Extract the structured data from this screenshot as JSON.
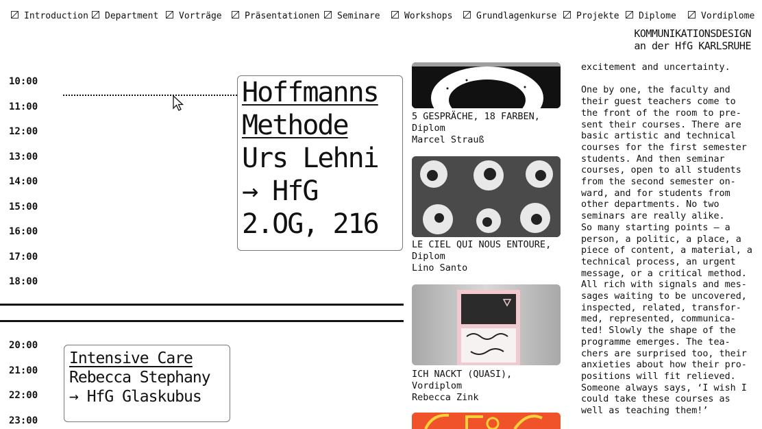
{
  "nav": {
    "items": [
      "Introduction",
      "Department",
      "Vorträge",
      "Präsentationen",
      "Seminare",
      "Workshops",
      "Grundlagenkurse",
      "Projekte",
      "Diplome",
      "Vordiplome"
    ]
  },
  "brand": {
    "line1": "KOMMUNIKATIONSDESIGN",
    "line2": "an der HfG KARLSRUHE"
  },
  "schedule": {
    "times_top": [
      "10:00",
      "11:00",
      "12:00",
      "13:00",
      "14:00",
      "15:00",
      "16:00",
      "17:00",
      "18:00"
    ],
    "times_bottom": [
      "20:00",
      "21:00",
      "22:00",
      "23:00"
    ],
    "event1": {
      "title1": "Hoffmanns",
      "title2": "Methode",
      "person": "Urs Lehni",
      "location1": "→ HfG",
      "location2": "2.OG, 216"
    },
    "event2": {
      "title": "Intensive Care",
      "person": "Rebecca Stephany",
      "location": "→ HfG Glaskubus"
    }
  },
  "projects": [
    {
      "title": "5 GESPRÄCHE, 18 FARBEN,",
      "type": "Diplom",
      "author": "Marcel Strauß"
    },
    {
      "title": "LE CIEL QUI NOUS ENTOURE,",
      "type": "Diplom",
      "author": "Lino Santo"
    },
    {
      "title": "ICH NACKT (QUASI),",
      "type": "Vordiplom",
      "author": "Rebecca Zink"
    }
  ],
  "intro": {
    "p1": "excitement and uncertainty.",
    "p2": "One by one, the faculty and their guest teachers come to the front of the room to pre-sent their courses. There are basic artistic and technical courses for the first semester students. And then seminar courses, open to all students from the second semester on-ward, and for students from other departments. No two seminars are really alike.",
    "p3": "So many starting points — a person, a politic, a place, a piece of content, a material, a technical process, an urgent message, or a critical method. All rich with signals and mes-sages waiting to be uncovered, inspected, related, transfor-med, represented, communica-ted! Slowly the shape of the programme emerges. The tea-chers are surprised too, their anxieties about how their pro-positions will fit relieved. Someone always says, ‘I wish I could take these courses as well as teaching them!’"
  },
  "colors": {
    "accent": "#111111",
    "card_border": "#777777",
    "poster_orange": "#f0522a",
    "poster_yellow": "#f5d23a"
  }
}
